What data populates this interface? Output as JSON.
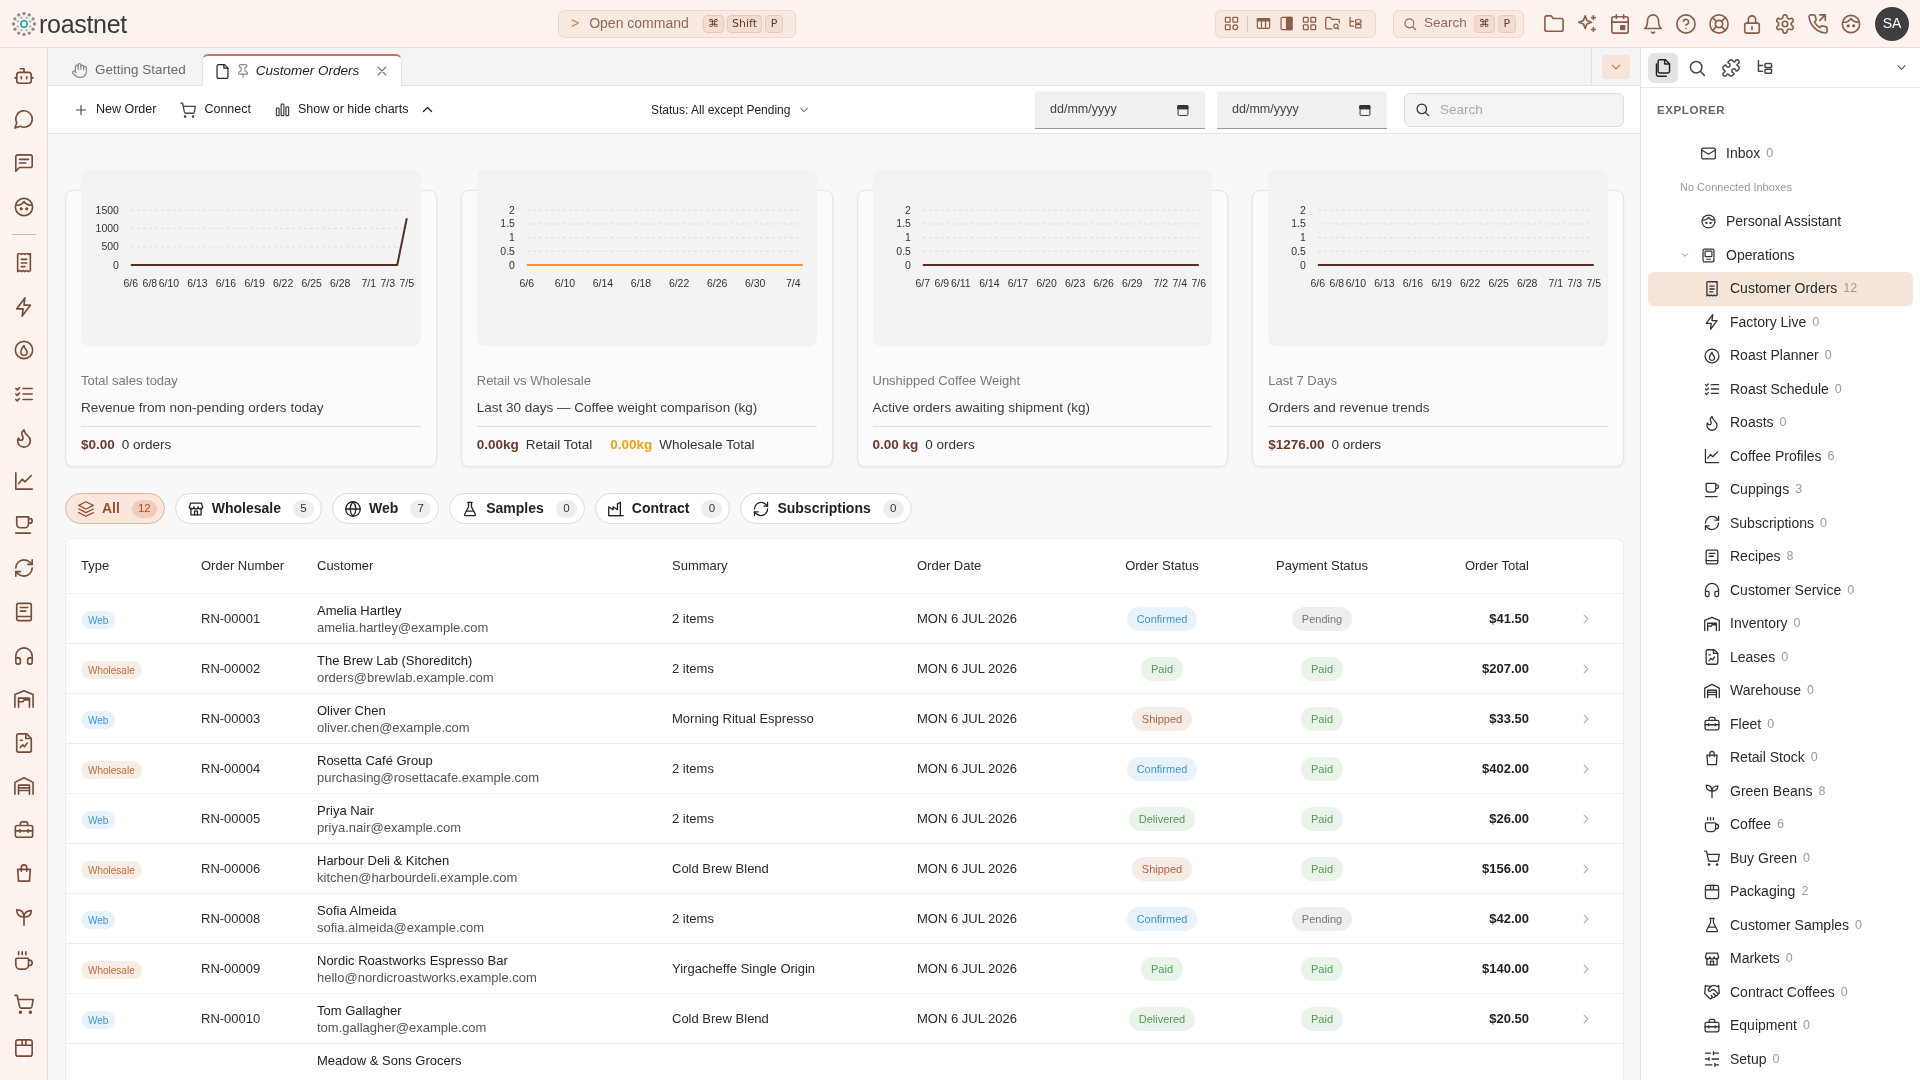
{
  "app": {
    "logo_text": "roastnet"
  },
  "command_bar": {
    "prompt": ">",
    "label": "Open command",
    "keys": [
      "⌘",
      "Shift",
      "P"
    ]
  },
  "search_shortcut": {
    "label": "Search",
    "keys": [
      "⌘",
      "P"
    ]
  },
  "user": {
    "initials": "SA"
  },
  "tabs": [
    {
      "label": "Getting Started",
      "selected": false,
      "pinned": false
    },
    {
      "label": "Customer Orders",
      "selected": true,
      "pinned": true
    }
  ],
  "toolbar": {
    "new_order": {
      "label": "New Order"
    },
    "connect": {
      "label": "Connect"
    },
    "charts_toggle": {
      "label": "Show or hide charts",
      "expanded": true
    },
    "status_filter": {
      "label": "Status: All except Pending"
    },
    "date_from": {
      "placeholder": "dd/mm/yyyy"
    },
    "date_to": {
      "placeholder": "dd/mm/yyyy"
    },
    "search": {
      "placeholder": "Search"
    }
  },
  "cards": [
    {
      "title": "Total sales today",
      "subtitle": "Revenue from non‑pending orders today",
      "stats": [
        {
          "amount": "$0.00",
          "caption": "0 orders",
          "color": "#6b3a2e"
        }
      ],
      "chart_data": {
        "type": "line",
        "grid": true,
        "categories": [
          "6/6",
          null,
          "6/8",
          null,
          "6/10",
          null,
          null,
          "6/13",
          null,
          null,
          "6/16",
          null,
          null,
          "6/19",
          null,
          null,
          "6/22",
          null,
          null,
          "6/25",
          null,
          null,
          "6/28",
          null,
          null,
          "7/1",
          null,
          "7/3",
          null,
          "7/5"
        ],
        "values": [
          0,
          0,
          0,
          0,
          0,
          0,
          0,
          0,
          0,
          0,
          0,
          0,
          0,
          0,
          0,
          0,
          0,
          0,
          0,
          0,
          0,
          0,
          0,
          0,
          0,
          0,
          0,
          0,
          0,
          1280
        ],
        "ylim": [
          0,
          1500
        ],
        "yticks": [
          0,
          500,
          1000,
          1500
        ]
      }
    },
    {
      "title": "Retail vs Wholesale",
      "subtitle": "Last 30 days — Coffee weight comparison (kg)",
      "stats": [
        {
          "amount": "0.00kg",
          "caption": "Retail Total",
          "color": "#6b3a2e"
        },
        {
          "amount": "0.00kg",
          "caption": "Wholesale Total",
          "color": "#eea315"
        }
      ],
      "chart_data": {
        "type": "line",
        "grid": true,
        "categories": [
          "6/6",
          null,
          null,
          null,
          "6/10",
          null,
          null,
          null,
          "6/14",
          null,
          null,
          null,
          "6/18",
          null,
          null,
          null,
          "6/22",
          null,
          null,
          null,
          "6/26",
          null,
          null,
          null,
          "6/30",
          null,
          null,
          null,
          "7/4",
          null
        ],
        "series": [
          {
            "color": "#ec9a2c",
            "values": [
              0,
              0,
              0,
              0,
              0,
              0,
              0,
              0,
              0,
              0,
              0,
              0,
              0,
              0,
              0,
              0,
              0,
              0,
              0,
              0,
              0,
              0,
              0,
              0,
              0,
              0,
              0,
              0,
              0,
              0
            ]
          }
        ],
        "ylim": [
          0,
          2
        ],
        "yticks": [
          0,
          0.5,
          1,
          1.5,
          2
        ]
      }
    },
    {
      "title": "Unshipped Coffee Weight",
      "subtitle": "Active orders awaiting shipment (kg)",
      "stats": [
        {
          "amount": "0.00 kg",
          "caption": "0 orders",
          "color": "#6b3a2e"
        }
      ],
      "chart_data": {
        "type": "line",
        "grid": true,
        "categories": [
          "6/7",
          null,
          "6/9",
          null,
          "6/11",
          null,
          null,
          "6/14",
          null,
          null,
          "6/17",
          null,
          null,
          "6/20",
          null,
          null,
          "6/23",
          null,
          null,
          "6/26",
          null,
          null,
          "6/29",
          null,
          null,
          "7/2",
          null,
          "7/4",
          null,
          "7/6"
        ],
        "values": [
          0,
          0,
          0,
          0,
          0,
          0,
          0,
          0,
          0,
          0,
          0,
          0,
          0,
          0,
          0,
          0,
          0,
          0,
          0,
          0,
          0,
          0,
          0,
          0,
          0,
          0,
          0,
          0,
          0,
          0
        ],
        "ylim": [
          0,
          2
        ],
        "yticks": [
          0,
          0.5,
          1,
          1.5,
          2
        ]
      }
    },
    {
      "title": "Last 7 Days",
      "subtitle": "Orders and revenue trends",
      "stats": [
        {
          "amount": "$1276.00",
          "caption": "0 orders",
          "color": "#6b3a2e"
        }
      ],
      "chart_data": {
        "type": "line",
        "grid": true,
        "categories": [
          "6/6",
          null,
          "6/8",
          null,
          "6/10",
          null,
          null,
          "6/13",
          null,
          null,
          "6/16",
          null,
          null,
          "6/19",
          null,
          null,
          "6/22",
          null,
          null,
          "6/25",
          null,
          null,
          "6/28",
          null,
          null,
          "7/1",
          null,
          "7/3",
          null,
          "7/5"
        ],
        "values": [
          0,
          0,
          0,
          0,
          0,
          0,
          0,
          0,
          0,
          0,
          0,
          0,
          0,
          0,
          0,
          0,
          0,
          0,
          0,
          0,
          0,
          0,
          0,
          0,
          0,
          0,
          0,
          0,
          0,
          0
        ],
        "ylim": [
          0,
          2
        ],
        "yticks": [
          0,
          0.5,
          1,
          1.5,
          2
        ]
      }
    }
  ],
  "filters": [
    {
      "label": "All",
      "count": "12",
      "selected": true
    },
    {
      "label": "Wholesale",
      "count": "5",
      "selected": false
    },
    {
      "label": "Web",
      "count": "7",
      "selected": false
    },
    {
      "label": "Samples",
      "count": "0",
      "selected": false
    },
    {
      "label": "Contract",
      "count": "0",
      "selected": false
    },
    {
      "label": "Subscriptions",
      "count": "0",
      "selected": false
    }
  ],
  "table": {
    "columns": [
      "Type",
      "Order Number",
      "Customer",
      "Summary",
      "Order Date",
      "Order Status",
      "Payment Status",
      "Order Total"
    ],
    "rows": [
      {
        "kind": "order",
        "type": {
          "label": "Web",
          "color": "#3f95da"
        },
        "number": "RN-00001",
        "customer": {
          "name": "Amelia Hartley",
          "email": "amelia.hartley@example.com"
        },
        "summary": "2 items",
        "date": "MON 6 JUL 2026",
        "order_status": {
          "label": "Confirmed",
          "color": "#3f95da"
        },
        "payment_status": {
          "label": "Pending",
          "color": "#777777"
        },
        "total": "$41.50"
      },
      {
        "kind": "order",
        "type": {
          "label": "Wholesale",
          "color": "#c0683c"
        },
        "number": "RN-00002",
        "customer": {
          "name": "The Brew Lab (Shoreditch)",
          "email": "orders@brewlab.example.com"
        },
        "summary": "2 items",
        "date": "MON 6 JUL 2026",
        "order_status": {
          "label": "Paid",
          "color": "#4f9f4f"
        },
        "payment_status": {
          "label": "Paid",
          "color": "#4f9f4f"
        },
        "total": "$207.00"
      },
      {
        "kind": "order",
        "type": {
          "label": "Web",
          "color": "#3f95da"
        },
        "number": "RN-00003",
        "customer": {
          "name": "Oliver Chen",
          "email": "oliver.chen@example.com"
        },
        "summary": "Morning Ritual Espresso",
        "date": "MON 6 JUL 2026",
        "order_status": {
          "label": "Shipped",
          "color": "#b9623a"
        },
        "payment_status": {
          "label": "Paid",
          "color": "#4f9f4f"
        },
        "total": "$33.50"
      },
      {
        "kind": "order",
        "type": {
          "label": "Wholesale",
          "color": "#c0683c"
        },
        "number": "RN-00004",
        "customer": {
          "name": "Rosetta Café Group",
          "email": "purchasing@rosettacafe.example.com"
        },
        "summary": "2 items",
        "date": "MON 6 JUL 2026",
        "order_status": {
          "label": "Confirmed",
          "color": "#3f95da"
        },
        "payment_status": {
          "label": "Paid",
          "color": "#4f9f4f"
        },
        "total": "$402.00"
      },
      {
        "kind": "order",
        "type": {
          "label": "Web",
          "color": "#3f95da"
        },
        "number": "RN-00005",
        "customer": {
          "name": "Priya Nair",
          "email": "priya.nair@example.com"
        },
        "summary": "2 items",
        "date": "MON 6 JUL 2026",
        "order_status": {
          "label": "Delivered",
          "color": "#4f9f4f"
        },
        "payment_status": {
          "label": "Paid",
          "color": "#4f9f4f"
        },
        "total": "$26.00"
      },
      {
        "kind": "order",
        "type": {
          "label": "Wholesale",
          "color": "#c0683c"
        },
        "number": "RN-00006",
        "customer": {
          "name": "Harbour Deli & Kitchen",
          "email": "kitchen@harbourdeli.example.com"
        },
        "summary": "Cold Brew Blend",
        "date": "MON 6 JUL 2026",
        "order_status": {
          "label": "Shipped",
          "color": "#b9623a"
        },
        "payment_status": {
          "label": "Paid",
          "color": "#4f9f4f"
        },
        "total": "$156.00"
      },
      {
        "kind": "order",
        "type": {
          "label": "Web",
          "color": "#3f95da"
        },
        "number": "RN-00008",
        "customer": {
          "name": "Sofia Almeida",
          "email": "sofia.almeida@example.com"
        },
        "summary": "2 items",
        "date": "MON 6 JUL 2026",
        "order_status": {
          "label": "Confirmed",
          "color": "#3f95da"
        },
        "payment_status": {
          "label": "Pending",
          "color": "#777777"
        },
        "total": "$42.00"
      },
      {
        "kind": "order",
        "type": {
          "label": "Wholesale",
          "color": "#c0683c"
        },
        "number": "RN-00009",
        "customer": {
          "name": "Nordic Roastworks Espresso Bar",
          "email": "hello@nordicroastworks.example.com"
        },
        "summary": "Yirgacheffe Single Origin",
        "date": "MON 6 JUL 2026",
        "order_status": {
          "label": "Paid",
          "color": "#4f9f4f"
        },
        "payment_status": {
          "label": "Paid",
          "color": "#4f9f4f"
        },
        "total": "$140.00"
      },
      {
        "kind": "order",
        "type": {
          "label": "Web",
          "color": "#3f95da"
        },
        "number": "RN-00010",
        "customer": {
          "name": "Tom Gallagher",
          "email": "tom.gallagher@example.com"
        },
        "summary": "Cold Brew Blend",
        "date": "MON 6 JUL 2026",
        "order_status": {
          "label": "Delivered",
          "color": "#4f9f4f"
        },
        "payment_status": {
          "label": "Paid",
          "color": "#4f9f4f"
        },
        "total": "$20.50"
      },
      {
        "kind": "partial",
        "customer": {
          "name": "Meadow & Sons Grocers"
        }
      }
    ]
  },
  "explorer": {
    "panel_tabs": [
      {
        "selected": true
      },
      {
        "selected": false
      },
      {
        "selected": false
      },
      {
        "selected": false
      }
    ],
    "title": "EXPLORER",
    "items": [
      {
        "kind": "item",
        "label": "Inbox",
        "count": "0",
        "selected": false
      },
      {
        "kind": "note",
        "label": "No Connected Inboxes"
      },
      {
        "kind": "item",
        "label": "Personal Assistant",
        "selected": false
      },
      {
        "kind": "folder",
        "label": "Operations",
        "expanded": true,
        "selected": false,
        "children": [
          {
            "label": "Customer Orders",
            "count": "12",
            "selected": true
          },
          {
            "label": "Factory Live",
            "count": "0",
            "selected": false
          },
          {
            "label": "Roast Planner",
            "count": "0",
            "selected": false
          },
          {
            "label": "Roast Schedule",
            "count": "0",
            "selected": false
          },
          {
            "label": "Roasts",
            "count": "0",
            "selected": false
          },
          {
            "label": "Coffee Profiles",
            "count": "6",
            "selected": false
          },
          {
            "label": "Cuppings",
            "count": "3",
            "selected": false
          },
          {
            "label": "Subscriptions",
            "count": "0",
            "selected": false
          },
          {
            "label": "Recipes",
            "count": "8",
            "selected": false
          },
          {
            "label": "Customer Service",
            "count": "0",
            "selected": false
          },
          {
            "label": "Inventory",
            "count": "0",
            "selected": false
          },
          {
            "label": "Leases",
            "count": "0",
            "selected": false
          },
          {
            "label": "Warehouse",
            "count": "0",
            "selected": false
          },
          {
            "label": "Fleet",
            "count": "0",
            "selected": false
          },
          {
            "label": "Retail Stock",
            "count": "0",
            "selected": false
          },
          {
            "label": "Green Beans",
            "count": "8",
            "selected": false
          },
          {
            "label": "Coffee",
            "count": "6",
            "selected": false
          },
          {
            "label": "Buy Green",
            "count": "0",
            "selected": false
          },
          {
            "label": "Packaging",
            "count": "2",
            "selected": false
          },
          {
            "label": "Customer Samples",
            "count": "0",
            "selected": false
          },
          {
            "label": "Markets",
            "count": "0",
            "selected": false
          },
          {
            "label": "Contract Coffees",
            "count": "0",
            "selected": false
          },
          {
            "label": "Equipment",
            "count": "0",
            "selected": false
          },
          {
            "label": "Setup",
            "count": "0",
            "selected": false
          }
        ]
      }
    ]
  }
}
